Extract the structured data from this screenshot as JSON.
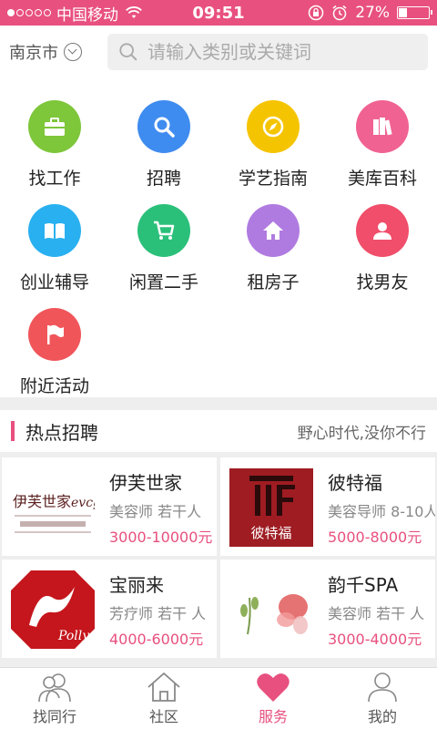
{
  "status": {
    "carrier": "中国移动",
    "time": "09:51",
    "battery_text": "27%",
    "battery_level": 0.27
  },
  "search": {
    "city": "南京市",
    "placeholder": "请输入类别或关键词"
  },
  "categories": [
    {
      "label": "找工作",
      "color": "#7ec63a",
      "icon": "briefcase-icon"
    },
    {
      "label": "招聘",
      "color": "#3f8cf0",
      "icon": "magnifier-icon"
    },
    {
      "label": "学艺指南",
      "color": "#f5c400",
      "icon": "compass-icon"
    },
    {
      "label": "美库百科",
      "color": "#f06292",
      "icon": "books-icon"
    },
    {
      "label": "创业辅导",
      "color": "#29b0f0",
      "icon": "open-book-icon"
    },
    {
      "label": "闲置二手",
      "color": "#2bc07a",
      "icon": "cart-icon"
    },
    {
      "label": "租房子",
      "color": "#b07be0",
      "icon": "house-icon"
    },
    {
      "label": "找男友",
      "color": "#f04e6a",
      "icon": "person-icon"
    },
    {
      "label": "附近活动",
      "color": "#f0555a",
      "icon": "flag-icon"
    }
  ],
  "hot": {
    "title": "热点招聘",
    "slogan": "野心时代,没你不行"
  },
  "jobs": [
    {
      "name": "伊芙世家",
      "desc": "美容师 若干人",
      "salary": "3000-10000元",
      "logo_text": "伊芙世家"
    },
    {
      "name": "彼特福",
      "desc": "美容导师 8-10人",
      "salary": "5000-8000元",
      "logo_text": "彼特福"
    },
    {
      "name": "宝丽来",
      "desc": "芳疗师 若干 人",
      "salary": "4000-6000元",
      "logo_text": "Polly"
    },
    {
      "name": "韵千SPA",
      "desc": "美容师 若干 人",
      "salary": "3000-4000元",
      "logo_text": ""
    }
  ],
  "nav": [
    {
      "label": "找同行",
      "icon": "peers-icon"
    },
    {
      "label": "社区",
      "icon": "community-home-icon"
    },
    {
      "label": "服务",
      "icon": "heart-icon",
      "active": true
    },
    {
      "label": "我的",
      "icon": "profile-icon"
    }
  ]
}
